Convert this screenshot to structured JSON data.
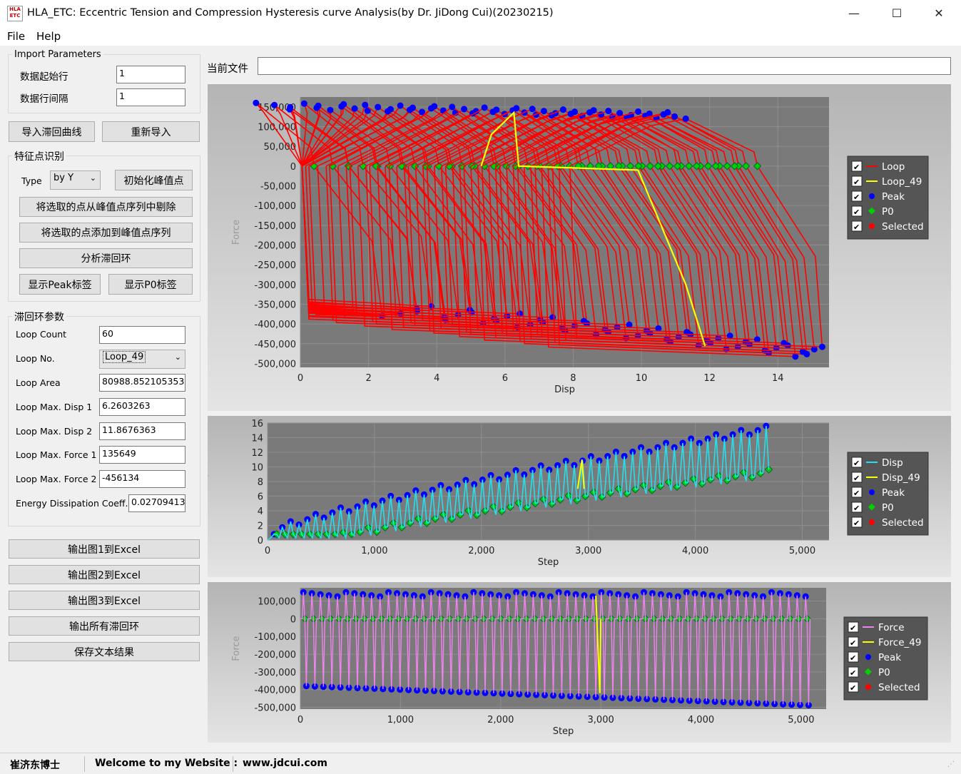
{
  "window": {
    "title": "HLA_ETC: Eccentric Tension and Compression Hysteresis curve Analysis(by Dr. JiDong Cui)(20230215)",
    "icon_text": "HLA ETC",
    "minimize": "—",
    "maximize": "☐",
    "close": "✕"
  },
  "menu": {
    "file": "File",
    "help": "Help"
  },
  "import_params": {
    "title": "Import Parameters",
    "start_row_label": "数据起始行",
    "start_row_value": "1",
    "interval_label": "数据行间隔",
    "interval_value": "1"
  },
  "buttons": {
    "import_curve": "导入滞回曲线",
    "reimport": "重新导入",
    "init_peak": "初始化峰值点",
    "remove_selected": "将选取的点从峰值点序列中剔除",
    "add_selected": "将选取的点添加到峰值点序列",
    "analyze": "分析滞回环",
    "show_peak_label": "显示Peak标签",
    "show_p0_label": "显示P0标签",
    "export_fig1": "输出图1到Excel",
    "export_fig2": "输出图2到Excel",
    "export_fig3": "输出图3到Excel",
    "export_all": "输出所有滞回环",
    "save_text": "保存文本结果"
  },
  "feature": {
    "title": "特征点识别",
    "type_label": "Type",
    "type_value": "by Y"
  },
  "loop_params": {
    "title": "滞回环参数",
    "rows": [
      {
        "label": "Loop Count",
        "value": "60"
      },
      {
        "label": "Loop No.",
        "value": "Loop_49"
      },
      {
        "label": "Loop Area",
        "value": "80988.852105353"
      },
      {
        "label": "Loop Max. Disp 1",
        "value": "6.2603263"
      },
      {
        "label": "Loop Max. Disp 2",
        "value": "11.8676363"
      },
      {
        "label": "Loop Max. Force 1",
        "value": "135649"
      },
      {
        "label": "Loop Max. Force 2",
        "value": "-456134"
      },
      {
        "label": "Energy Dissipation Coeff.",
        "value": "0.02709413"
      }
    ]
  },
  "current_file": {
    "label": "当前文件",
    "value": ""
  },
  "colors": {
    "loop": "#ff0000",
    "highlight": "#ffff00",
    "peak": "#0000ff",
    "p0": "#00d000",
    "selected": "#ff0000",
    "disp": "#22e0ee",
    "force": "#ee82ee",
    "plot_bg": "#7a7a7a",
    "legend_bg": "#555555"
  },
  "chart_data": [
    {
      "type": "line",
      "xlabel": "Disp",
      "ylabel": "Force",
      "xlim": [
        0,
        15.5
      ],
      "ylim": [
        -510000,
        175000
      ],
      "xticks": [
        "0",
        "2",
        "4",
        "6",
        "8",
        "10",
        "12",
        "14"
      ],
      "yticks": [
        "150,000",
        "100,000",
        "50,000",
        "0",
        "-50,000",
        "-100,000",
        "-150,000",
        "-200,000",
        "-250,000",
        "-300,000",
        "-350,000",
        "-400,000",
        "-450,000",
        "-500,000"
      ],
      "legend": [
        "Loop",
        "Loop_49",
        "Peak",
        "P0",
        "Selected"
      ],
      "grid": true,
      "highlight_loop": {
        "max_disp_1": 6.2603263,
        "max_disp_2": 11.8676363,
        "max_force_1": 135649,
        "max_force_2": -456134
      }
    },
    {
      "type": "line",
      "xlabel": "Step",
      "ylabel": "Disp",
      "xlim": [
        0,
        5250
      ],
      "ylim": [
        0,
        16
      ],
      "xticks": [
        "0",
        "1,000",
        "2,000",
        "3,000",
        "4,000",
        "5,000"
      ],
      "yticks": [
        "16",
        "14",
        "12",
        "10",
        "8",
        "6",
        "4",
        "2",
        "0"
      ],
      "legend": [
        "Disp",
        "Disp_49",
        "Peak",
        "P0",
        "Selected"
      ],
      "grid": true
    },
    {
      "type": "line",
      "xlabel": "Step",
      "ylabel": "Force",
      "xlim": [
        0,
        5250
      ],
      "ylim": [
        -510000,
        175000
      ],
      "xticks": [
        "0",
        "1,000",
        "2,000",
        "3,000",
        "4,000",
        "5,000"
      ],
      "yticks": [
        "100,000",
        "0",
        "-100,000",
        "-200,000",
        "-300,000",
        "-400,000",
        "-500,000"
      ],
      "legend": [
        "Force",
        "Force_49",
        "Peak",
        "P0",
        "Selected"
      ],
      "grid": true
    }
  ],
  "status": {
    "author": "崔济东博士",
    "welcome": "Welcome to my Website :",
    "site": "www.jdcui.com"
  }
}
